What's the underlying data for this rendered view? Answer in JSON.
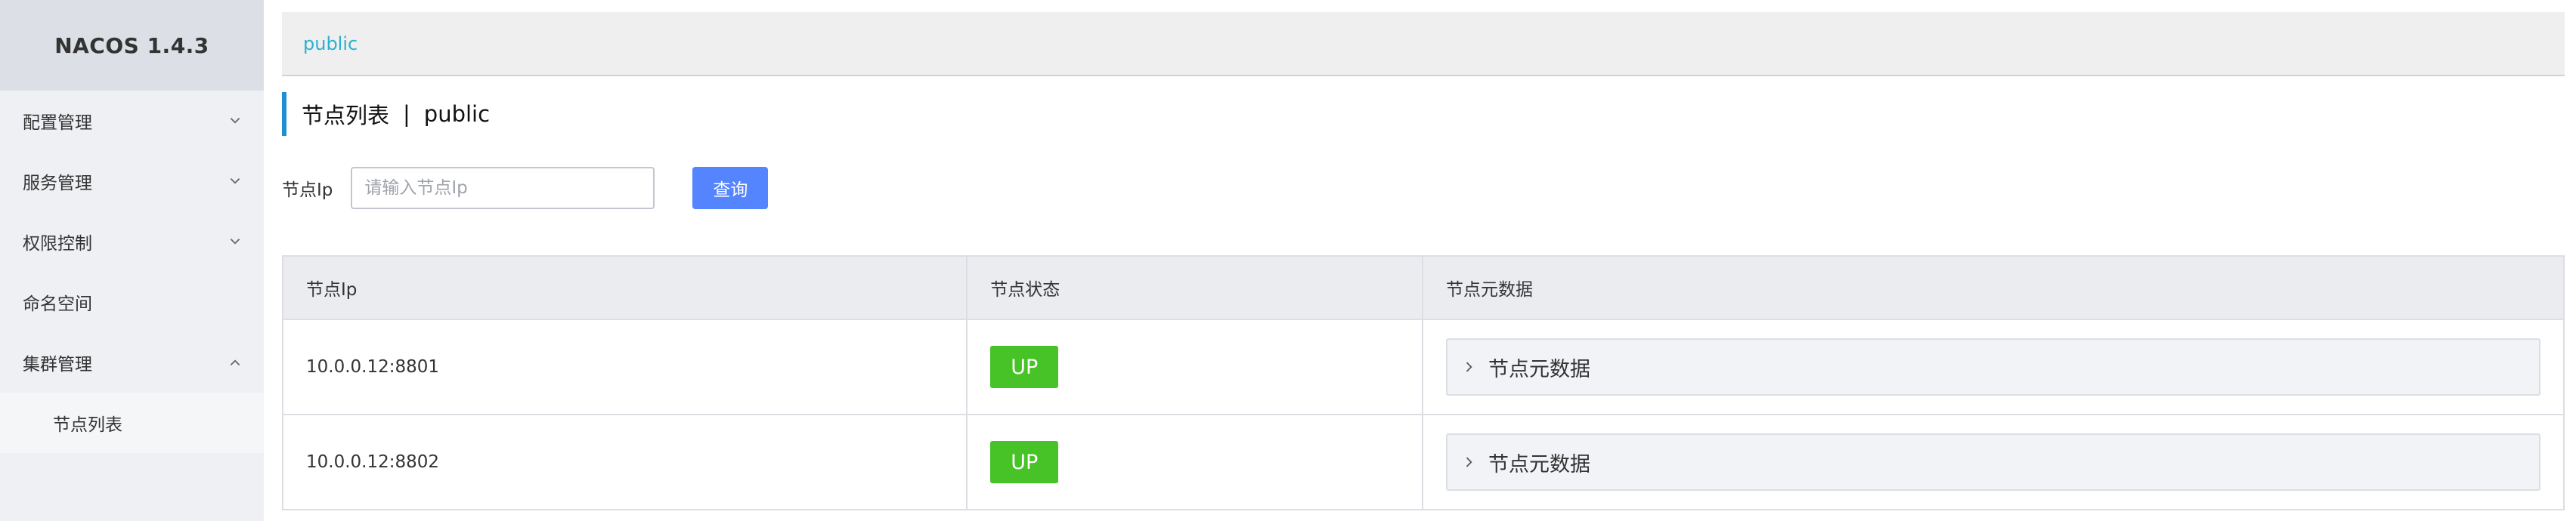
{
  "app": {
    "title": "NACOS 1.4.3"
  },
  "sidebar": {
    "items": [
      {
        "label": "配置管理",
        "expanded": false
      },
      {
        "label": "服务管理",
        "expanded": false
      },
      {
        "label": "权限控制",
        "expanded": false
      },
      {
        "label": "命名空间"
      },
      {
        "label": "集群管理",
        "expanded": true
      }
    ],
    "sub_items": [
      {
        "label": "节点列表"
      }
    ]
  },
  "namespace_bar": {
    "current": "public"
  },
  "page": {
    "title": "节点列表",
    "separator": "|",
    "namespace": "public"
  },
  "filter": {
    "label": "节点Ip",
    "placeholder": "请输入节点Ip",
    "value": "",
    "query_label": "查询"
  },
  "table": {
    "headers": [
      "节点Ip",
      "节点状态",
      "节点元数据"
    ],
    "rows": [
      {
        "ip": "10.0.0.12:8801",
        "state": "UP",
        "meta_label": "节点元数据"
      },
      {
        "ip": "10.0.0.12:8802",
        "state": "UP",
        "meta_label": "节点元数据"
      }
    ]
  },
  "colors": {
    "accent": "#5584ff",
    "link": "#2cb0d0",
    "status_up": "#47c227",
    "title_bar": "#1f8fd1"
  }
}
